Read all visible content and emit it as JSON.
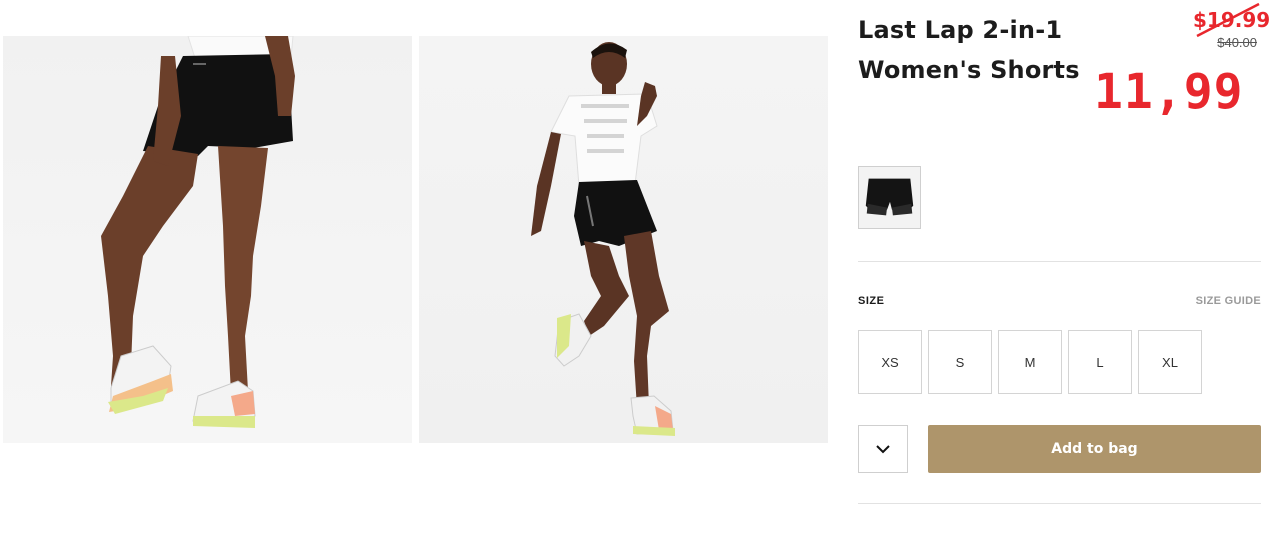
{
  "product": {
    "title_line1": "Last Lap 2-in-1",
    "title_line2": "Women's Shorts",
    "old_price": "$19.99",
    "list_price": "$40.00",
    "new_price": "11,99"
  },
  "sizes": {
    "label": "SIZE",
    "guide_label": "SIZE GUIDE",
    "options": [
      "XS",
      "S",
      "M",
      "L",
      "XL"
    ]
  },
  "cart": {
    "add_label": "Add to bag",
    "quantity_icon": "chevron-down-icon"
  },
  "colors": {
    "price_red": "#e8272d",
    "add_button": "#ae956b",
    "title": "#1c1c1c"
  }
}
